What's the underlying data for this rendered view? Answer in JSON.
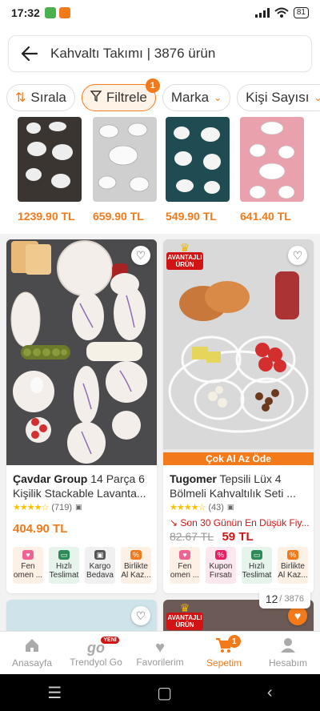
{
  "status_bar": {
    "time": "17:32",
    "battery": "81"
  },
  "search": {
    "query": "Kahvaltı Takımı | 3876 ürün"
  },
  "chips": {
    "sort_label": "Sırala",
    "filter_label": "Filtrele",
    "filter_count": "1",
    "brand_label": "Marka",
    "persons_label": "Kişi Sayısı"
  },
  "mini_products": [
    {
      "price": "1239.90 TL"
    },
    {
      "price": "659.90 TL"
    },
    {
      "price": "549.90 TL"
    },
    {
      "price": "641.40 TL"
    }
  ],
  "products": [
    {
      "brand": "Çavdar Group",
      "name": "14 Parça 6 Kişilik Stackable Lavanta...",
      "rating_count": "(719)",
      "stars": "★★★★☆",
      "price": "404.90 TL",
      "perks": [
        {
          "label": "Fen omen ..."
        },
        {
          "label": "Hızlı Teslimat"
        },
        {
          "label": "Kargo Bedava"
        },
        {
          "label": "Birlikte Al Kaz..."
        }
      ]
    },
    {
      "brand": "Tugomer",
      "name": "Tepsili Lüx 4 Bölmeli Kahvaltılık Seti ...",
      "rating_count": "(43)",
      "stars": "★★★★☆",
      "badge_top": "AVANTAJLI",
      "badge_bottom": "ÜRÜN",
      "deal": "Çok Al Az Öde",
      "price_note": "↘ Son 30 Günün En Düşük Fiy...",
      "old_price": "82.67 TL",
      "price": "59 TL",
      "perks": [
        {
          "label": "Fen omen ..."
        },
        {
          "label": "Kupon Fırsatı"
        },
        {
          "label": "Hızlı Teslimat"
        },
        {
          "label": "Birlikte Al Kaz..."
        }
      ]
    }
  ],
  "next_row": {
    "badge_top": "AVANTAJLI",
    "badge_bottom": "ÜRÜN"
  },
  "page_indicator": {
    "current": "12",
    "total": "/ 3876"
  },
  "bottom_nav": [
    {
      "label": "Anasayfa",
      "icon": "home-icon"
    },
    {
      "label": "Trendyol Go",
      "icon": "go-icon",
      "badge": "YENİ"
    },
    {
      "label": "Favorilerim",
      "icon": "heart-icon"
    },
    {
      "label": "Sepetim",
      "icon": "cart-icon",
      "badge": "1"
    },
    {
      "label": "Hesabım",
      "icon": "user-icon"
    }
  ],
  "colors": {
    "accent": "#f27a1a",
    "discount_red": "#d21313",
    "star": "#ffc000"
  }
}
